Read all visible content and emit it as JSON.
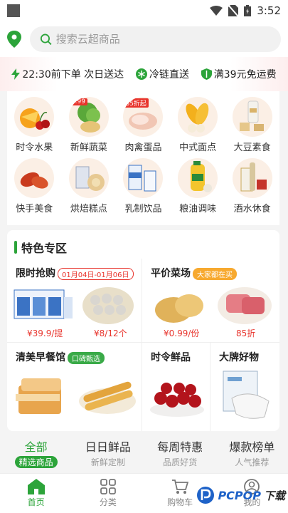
{
  "status": {
    "time": "3:52"
  },
  "search": {
    "placeholder": "搜索云超商品"
  },
  "promos": [
    {
      "icon": "lightning-icon",
      "text": "22:30前下单 次日送达"
    },
    {
      "icon": "snowflake-icon",
      "text": "冷链直送"
    },
    {
      "icon": "shield-icon",
      "text": "满39元免运费"
    }
  ],
  "categories": [
    {
      "name": "时令水果",
      "icon": "fruit-icon"
    },
    {
      "name": "新鲜蔬菜",
      "icon": "vegetable-icon",
      "badge": "0.99"
    },
    {
      "name": "肉禽蛋品",
      "icon": "meat-icon",
      "badge": "85折起"
    },
    {
      "name": "中式面点",
      "icon": "bread-icon"
    },
    {
      "name": "大豆素食",
      "icon": "soy-icon"
    },
    {
      "name": "快手美食",
      "icon": "fastfood-icon"
    },
    {
      "name": "烘焙糕点",
      "icon": "bakery-icon"
    },
    {
      "name": "乳制饮品",
      "icon": "milk-icon"
    },
    {
      "name": "粮油调味",
      "icon": "oil-icon"
    },
    {
      "name": "酒水休食",
      "icon": "wine-icon"
    }
  ],
  "special": {
    "title": "特色专区",
    "flash": {
      "title": "限时抢购",
      "tag": "01月04日-01月06日",
      "price1": "¥39.9/提",
      "price2": "¥8/12个"
    },
    "veg": {
      "title": "平价菜场",
      "tag": "大家都在买",
      "price1": "¥0.99/份",
      "price2": "85折"
    },
    "breakfast": {
      "title": "清美早餐馆",
      "tag": "口碑甄选"
    },
    "fresh": {
      "title": "时令鲜品"
    },
    "brand": {
      "title": "大牌好物"
    }
  },
  "tabs": [
    {
      "title": "全部",
      "sub": "精选商品"
    },
    {
      "title": "日日鲜品",
      "sub": "新鲜定制"
    },
    {
      "title": "每周特惠",
      "sub": "品质好货"
    },
    {
      "title": "爆款榜单",
      "sub": "人气推荐"
    }
  ],
  "nav": [
    {
      "label": "首页",
      "icon": "home-icon"
    },
    {
      "label": "分类",
      "icon": "grid-icon"
    },
    {
      "label": "购物车",
      "icon": "cart-icon"
    },
    {
      "label": "我的",
      "icon": "user-icon"
    }
  ],
  "watermark": {
    "brand": "PCPOP",
    "suffix": "下载"
  },
  "colors": {
    "accent": "#2ca43a",
    "price": "#e8332b"
  }
}
